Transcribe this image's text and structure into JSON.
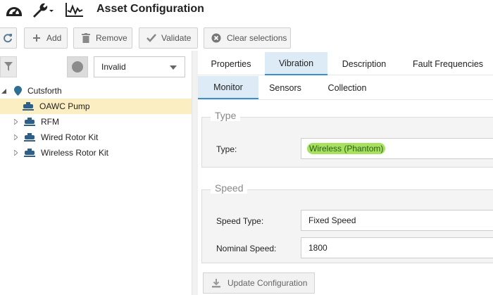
{
  "app": {
    "title": "Asset Configuration",
    "header_icons": [
      "speedometer-icon",
      "wrench-icon",
      "trend-chart-icon"
    ]
  },
  "toolbar": {
    "refresh_icon": "refresh-icon",
    "add_label": "Add",
    "remove_label": "Remove",
    "validate_label": "Validate",
    "clear_label": "Clear selections"
  },
  "left": {
    "filter_icon": "funnel-icon",
    "status_filter": {
      "selected": "Invalid"
    },
    "tree": [
      {
        "label": "Cutsforth",
        "level": 0,
        "icon": "location-pin-icon",
        "expanded": true,
        "selected": false
      },
      {
        "label": "OAWC Pump",
        "level": 1,
        "icon": "pump-icon",
        "expanded": false,
        "selected": true,
        "has_children": false
      },
      {
        "label": "RFM",
        "level": 1,
        "icon": "pump-icon",
        "expanded": false,
        "selected": false,
        "has_children": true
      },
      {
        "label": "Wired Rotor Kit",
        "level": 1,
        "icon": "pump-icon",
        "expanded": false,
        "selected": false,
        "has_children": true
      },
      {
        "label": "Wireless Rotor Kit",
        "level": 1,
        "icon": "pump-icon",
        "expanded": false,
        "selected": false,
        "has_children": true
      }
    ]
  },
  "right": {
    "tabs": [
      "Properties",
      "Vibration",
      "Description",
      "Fault Frequencies"
    ],
    "active_tab": "Vibration",
    "subtabs": [
      "Monitor",
      "Sensors",
      "Collection"
    ],
    "active_subtab": "Monitor",
    "type_section": {
      "legend": "Type",
      "type_label": "Type:",
      "type_value": "Wireless (Phantom)"
    },
    "speed_section": {
      "legend": "Speed",
      "speed_type_label": "Speed Type:",
      "speed_type_value": "Fixed Speed",
      "nominal_speed_label": "Nominal Speed:",
      "nominal_speed_value": "1800"
    },
    "update_label": "Update Configuration"
  },
  "colors": {
    "selected_row": "#fbeec3",
    "active_tab": "#dcebf5",
    "active_tab_border": "#3b8fcf",
    "type_highlight": "#a8e05f",
    "location_pin": "#2f6f94"
  }
}
